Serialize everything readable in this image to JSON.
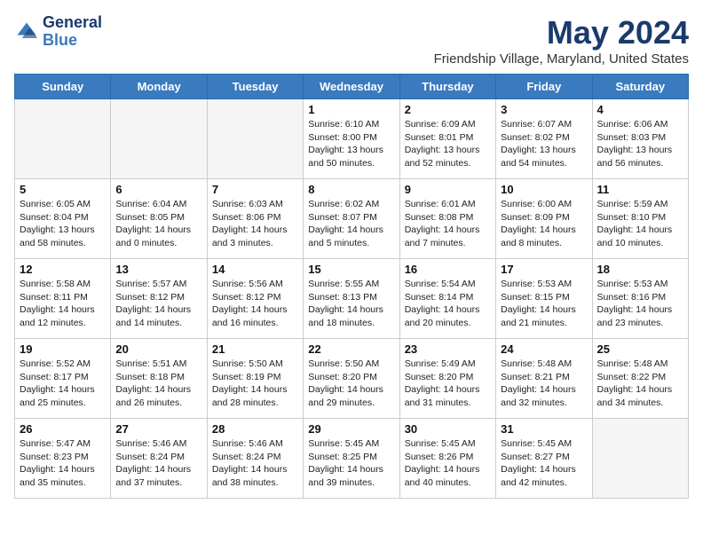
{
  "header": {
    "logo_line1": "General",
    "logo_line2": "Blue",
    "month_title": "May 2024",
    "location": "Friendship Village, Maryland, United States"
  },
  "days_of_week": [
    "Sunday",
    "Monday",
    "Tuesday",
    "Wednesday",
    "Thursday",
    "Friday",
    "Saturday"
  ],
  "weeks": [
    [
      {
        "day": "",
        "info": ""
      },
      {
        "day": "",
        "info": ""
      },
      {
        "day": "",
        "info": ""
      },
      {
        "day": "1",
        "info": "Sunrise: 6:10 AM\nSunset: 8:00 PM\nDaylight: 13 hours\nand 50 minutes."
      },
      {
        "day": "2",
        "info": "Sunrise: 6:09 AM\nSunset: 8:01 PM\nDaylight: 13 hours\nand 52 minutes."
      },
      {
        "day": "3",
        "info": "Sunrise: 6:07 AM\nSunset: 8:02 PM\nDaylight: 13 hours\nand 54 minutes."
      },
      {
        "day": "4",
        "info": "Sunrise: 6:06 AM\nSunset: 8:03 PM\nDaylight: 13 hours\nand 56 minutes."
      }
    ],
    [
      {
        "day": "5",
        "info": "Sunrise: 6:05 AM\nSunset: 8:04 PM\nDaylight: 13 hours\nand 58 minutes."
      },
      {
        "day": "6",
        "info": "Sunrise: 6:04 AM\nSunset: 8:05 PM\nDaylight: 14 hours\nand 0 minutes."
      },
      {
        "day": "7",
        "info": "Sunrise: 6:03 AM\nSunset: 8:06 PM\nDaylight: 14 hours\nand 3 minutes."
      },
      {
        "day": "8",
        "info": "Sunrise: 6:02 AM\nSunset: 8:07 PM\nDaylight: 14 hours\nand 5 minutes."
      },
      {
        "day": "9",
        "info": "Sunrise: 6:01 AM\nSunset: 8:08 PM\nDaylight: 14 hours\nand 7 minutes."
      },
      {
        "day": "10",
        "info": "Sunrise: 6:00 AM\nSunset: 8:09 PM\nDaylight: 14 hours\nand 8 minutes."
      },
      {
        "day": "11",
        "info": "Sunrise: 5:59 AM\nSunset: 8:10 PM\nDaylight: 14 hours\nand 10 minutes."
      }
    ],
    [
      {
        "day": "12",
        "info": "Sunrise: 5:58 AM\nSunset: 8:11 PM\nDaylight: 14 hours\nand 12 minutes."
      },
      {
        "day": "13",
        "info": "Sunrise: 5:57 AM\nSunset: 8:12 PM\nDaylight: 14 hours\nand 14 minutes."
      },
      {
        "day": "14",
        "info": "Sunrise: 5:56 AM\nSunset: 8:12 PM\nDaylight: 14 hours\nand 16 minutes."
      },
      {
        "day": "15",
        "info": "Sunrise: 5:55 AM\nSunset: 8:13 PM\nDaylight: 14 hours\nand 18 minutes."
      },
      {
        "day": "16",
        "info": "Sunrise: 5:54 AM\nSunset: 8:14 PM\nDaylight: 14 hours\nand 20 minutes."
      },
      {
        "day": "17",
        "info": "Sunrise: 5:53 AM\nSunset: 8:15 PM\nDaylight: 14 hours\nand 21 minutes."
      },
      {
        "day": "18",
        "info": "Sunrise: 5:53 AM\nSunset: 8:16 PM\nDaylight: 14 hours\nand 23 minutes."
      }
    ],
    [
      {
        "day": "19",
        "info": "Sunrise: 5:52 AM\nSunset: 8:17 PM\nDaylight: 14 hours\nand 25 minutes."
      },
      {
        "day": "20",
        "info": "Sunrise: 5:51 AM\nSunset: 8:18 PM\nDaylight: 14 hours\nand 26 minutes."
      },
      {
        "day": "21",
        "info": "Sunrise: 5:50 AM\nSunset: 8:19 PM\nDaylight: 14 hours\nand 28 minutes."
      },
      {
        "day": "22",
        "info": "Sunrise: 5:50 AM\nSunset: 8:20 PM\nDaylight: 14 hours\nand 29 minutes."
      },
      {
        "day": "23",
        "info": "Sunrise: 5:49 AM\nSunset: 8:20 PM\nDaylight: 14 hours\nand 31 minutes."
      },
      {
        "day": "24",
        "info": "Sunrise: 5:48 AM\nSunset: 8:21 PM\nDaylight: 14 hours\nand 32 minutes."
      },
      {
        "day": "25",
        "info": "Sunrise: 5:48 AM\nSunset: 8:22 PM\nDaylight: 14 hours\nand 34 minutes."
      }
    ],
    [
      {
        "day": "26",
        "info": "Sunrise: 5:47 AM\nSunset: 8:23 PM\nDaylight: 14 hours\nand 35 minutes."
      },
      {
        "day": "27",
        "info": "Sunrise: 5:46 AM\nSunset: 8:24 PM\nDaylight: 14 hours\nand 37 minutes."
      },
      {
        "day": "28",
        "info": "Sunrise: 5:46 AM\nSunset: 8:24 PM\nDaylight: 14 hours\nand 38 minutes."
      },
      {
        "day": "29",
        "info": "Sunrise: 5:45 AM\nSunset: 8:25 PM\nDaylight: 14 hours\nand 39 minutes."
      },
      {
        "day": "30",
        "info": "Sunrise: 5:45 AM\nSunset: 8:26 PM\nDaylight: 14 hours\nand 40 minutes."
      },
      {
        "day": "31",
        "info": "Sunrise: 5:45 AM\nSunset: 8:27 PM\nDaylight: 14 hours\nand 42 minutes."
      },
      {
        "day": "",
        "info": ""
      }
    ]
  ]
}
